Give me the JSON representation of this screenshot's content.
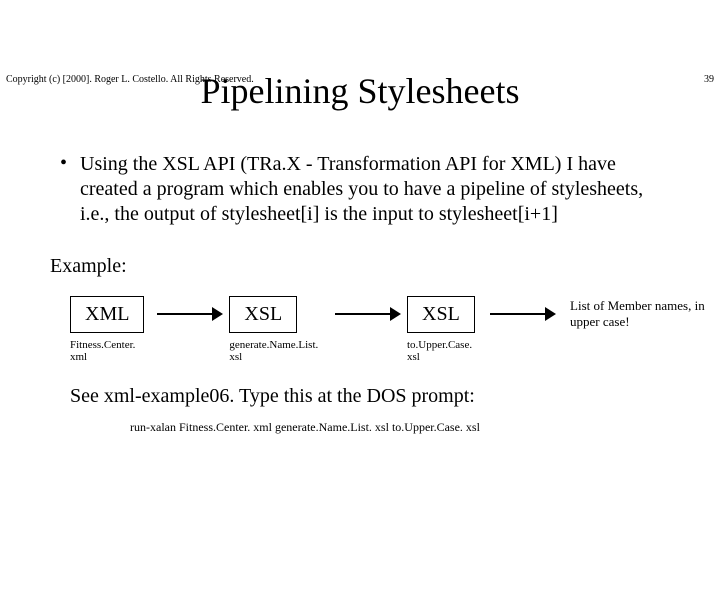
{
  "header": {
    "copyright": "Copyright (c) [2000]. Roger L. Costello. All Rights Reserved.",
    "page_number": "39"
  },
  "title": "Pipelining Stylesheets",
  "bullet": {
    "mark": "•",
    "text": "Using the XSL API (TRa.X - Transformation API for XML) I have created a program which enables you to have a pipeline of stylesheets, i.e., the output of stylesheet[i] is the input to stylesheet[i+1]"
  },
  "example_label": "Example:",
  "diagram": {
    "nodes": [
      {
        "label": "XML",
        "caption": "Fitness.Center. xml"
      },
      {
        "label": "XSL",
        "caption": "generate.Name.List. xsl"
      },
      {
        "label": "XSL",
        "caption": "to.Upper.Case. xsl"
      }
    ],
    "result": "List of Member names, in upper case!"
  },
  "footer": "See xml-example06.  Type this at the DOS prompt:",
  "command": "run-xalan Fitness.Center. xml generate.Name.List. xsl to.Upper.Case. xsl"
}
